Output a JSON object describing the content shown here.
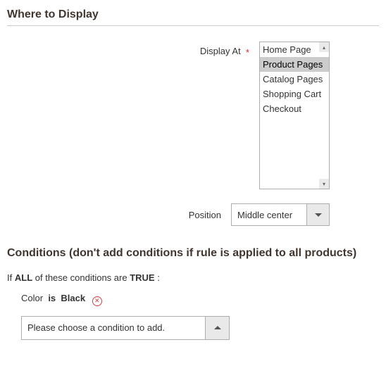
{
  "section1": {
    "title": "Where to Display",
    "display_at": {
      "label": "Display At",
      "required_mark": "*",
      "options": [
        "Home Page",
        "Product Pages",
        "Catalog Pages",
        "Shopping Cart",
        "Checkout"
      ],
      "selected_index": 1
    },
    "position": {
      "label": "Position",
      "value": "Middle center"
    }
  },
  "section2": {
    "title": "Conditions (don't add conditions if rule is applied to all products)",
    "intro": {
      "p1": "If",
      "b1": "ALL",
      "p2": " of these conditions are",
      "b2": "TRUE",
      "p3": " :"
    },
    "rule": {
      "attr": "Color",
      "op": "is",
      "val": "Black"
    },
    "add_select": {
      "placeholder": "Please choose a condition to add."
    }
  }
}
